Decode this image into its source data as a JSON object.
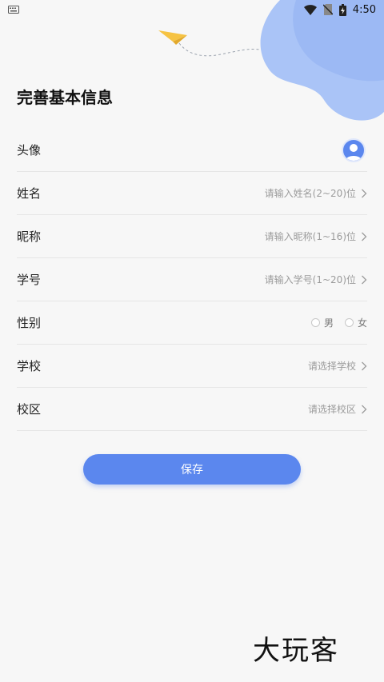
{
  "status_bar": {
    "time": "4:50",
    "icons": [
      "keyboard-icon",
      "wifi-icon",
      "no-sim-icon",
      "battery-charging-icon"
    ]
  },
  "page": {
    "title": "完善基本信息"
  },
  "form": {
    "avatar_label": "头像",
    "name": {
      "label": "姓名",
      "placeholder": "请输入姓名(2~20)位"
    },
    "nickname": {
      "label": "昵称",
      "placeholder": "请输入昵称(1~16)位"
    },
    "student_id": {
      "label": "学号",
      "placeholder": "请输入学号(1~20)位"
    },
    "gender": {
      "label": "性别",
      "options": [
        "男",
        "女"
      ]
    },
    "school": {
      "label": "学校",
      "placeholder": "请选择学校"
    },
    "campus": {
      "label": "校区",
      "placeholder": "请选择校区"
    }
  },
  "actions": {
    "save_label": "保存"
  },
  "watermark": {
    "text": "大玩客"
  },
  "colors": {
    "accent": "#5b87ee",
    "blob": "#aac4f7",
    "plane": "#f6c343"
  }
}
